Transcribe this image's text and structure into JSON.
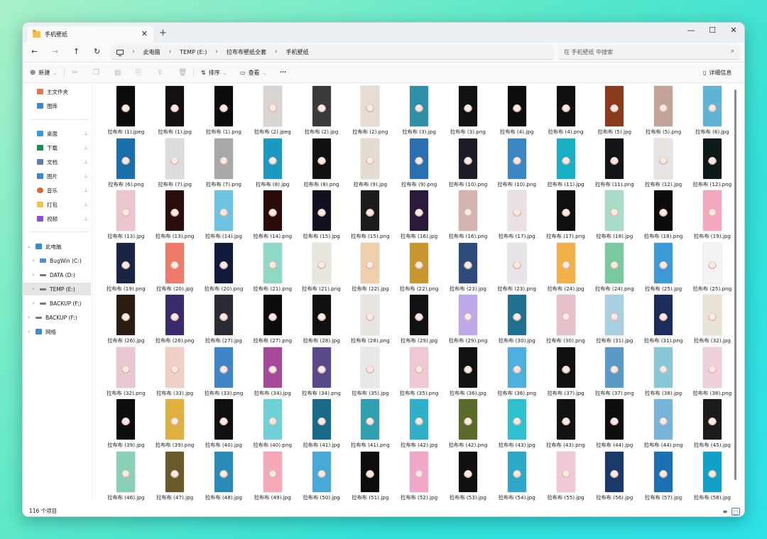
{
  "window": {
    "tab_title": "手机壁纸",
    "new_tab": "+",
    "close_tab": "✕",
    "minimize": "—",
    "maximize": "☐",
    "close": "✕"
  },
  "nav": {
    "back": "←",
    "forward": "→",
    "up": "↑",
    "refresh": "↻",
    "breadcrumbs": [
      "此电脑",
      "TEMP (E:)",
      "拉布布壁纸全套",
      "手机壁纸"
    ],
    "separator": "›",
    "search_placeholder": "在 手机壁纸 中搜索"
  },
  "toolbar": {
    "new_label": "新建",
    "sort_label": "排序",
    "view_label": "查看",
    "more_label": "···",
    "details_label": "详细信息"
  },
  "sidebar": {
    "quick": [
      {
        "label": "主文件夹",
        "icon": "home-icon",
        "color": "#e07a4a"
      },
      {
        "label": "图库",
        "icon": "gallery-icon",
        "color": "#3d86d8"
      }
    ],
    "pinned": [
      {
        "label": "桌面",
        "icon": "desktop-icon",
        "color": "#3a9ad9"
      },
      {
        "label": "下载",
        "icon": "download-icon",
        "color": "#1f8b4c"
      },
      {
        "label": "文档",
        "icon": "documents-icon",
        "color": "#5a7fa8"
      },
      {
        "label": "图片",
        "icon": "pictures-icon",
        "color": "#3f86c8"
      },
      {
        "label": "音乐",
        "icon": "music-icon",
        "color": "#e0663a"
      },
      {
        "label": "打包",
        "icon": "folder-icon",
        "color": "#f2c34c"
      },
      {
        "label": "视频",
        "icon": "videos-icon",
        "color": "#8c4fd0"
      }
    ],
    "pin_glyph": "📌",
    "this_pc": "此电脑",
    "drives": [
      {
        "label": "BugWin (C:)",
        "selected": false
      },
      {
        "label": "DATA (D:)",
        "selected": false
      },
      {
        "label": "TEMP (E:)",
        "selected": true
      },
      {
        "label": "BACKUP (F:)",
        "selected": false
      }
    ],
    "external": "BACKUP (F:)",
    "network": "网络"
  },
  "files": [
    "拉布布 (1).jpeg",
    "拉布布 (1).jpg",
    "拉布布 (1).png",
    "拉布布 (2).jpeg",
    "拉布布 (2).jpg",
    "拉布布 (2).png",
    "拉布布 (3).jpg",
    "拉布布 (3).png",
    "拉布布 (4).jpg",
    "拉布布 (4).png",
    "拉布布 (5).jpg",
    "拉布布 (5).png",
    "拉布布 (6).jpg",
    "拉布布 (6).png",
    "拉布布 (7).jpg",
    "拉布布 (7).png",
    "拉布布 (8).jpg",
    "拉布布 (8).png",
    "拉布布 (9).jpg",
    "拉布布 (9).png",
    "拉布布 (10).png",
    "拉布布 (10).png",
    "拉布布 (11).jpg",
    "拉布布 (11).png",
    "拉布布 (12).jpg",
    "拉布布 (12).png",
    "拉布布 (13).jpg",
    "拉布布 (13).png",
    "拉布布 (14).jpg",
    "拉布布 (14).png",
    "拉布布 (15).jpg",
    "拉布布 (15).png",
    "拉布布 (16).jpg",
    "拉布布 (16).png",
    "拉布布 (17).jpg",
    "拉布布 (17).png",
    "拉布布 (18).jpg",
    "拉布布 (18).png",
    "拉布布 (19).jpg",
    "拉布布 (19).png",
    "拉布布 (20).jpg",
    "拉布布 (20).png",
    "拉布布 (21).png",
    "拉布布 (21).png",
    "拉布布 (22).jpg",
    "拉布布 (22).png",
    "拉布布 (23).jpg",
    "拉布布 (23).png",
    "拉布布 (24).jpg",
    "拉布布 (24).png",
    "拉布布 (25).jpg",
    "拉布布 (25).png",
    "拉布布 (26).jpg",
    "拉布布 (26).png",
    "拉布布 (27).jpg",
    "拉布布 (27).png",
    "拉布布 (28).jpg",
    "拉布布 (28).png",
    "拉布布 (29).jpg",
    "拉布布 (29).png",
    "拉布布 (30).jpg",
    "拉布布 (30).png",
    "拉布布 (31).jpg",
    "拉布布 (31).png",
    "拉布布 (32).jpg",
    "拉布布 (32).png",
    "拉布布 (33).jpg",
    "拉布布 (33).png",
    "拉布布 (34).jpg",
    "拉布布 (34).png",
    "拉布布 (35).jpg",
    "拉布布 (35).png",
    "拉布布 (36).jpg",
    "拉布布 (36).png",
    "拉布布 (37).jpg",
    "拉布布 (37).png",
    "拉布布 (38).jpg",
    "拉布布 (38).png",
    "拉布布 (39).jpg",
    "拉布布 (39).png",
    "拉布布 (40).jpg",
    "拉布布 (40).png",
    "拉布布 (41).jpg",
    "拉布布 (41).png",
    "拉布布 (42).jpg",
    "拉布布 (42).png",
    "拉布布 (43).jpg",
    "拉布布 (43).png",
    "拉布布 (44).jpg",
    "拉布布 (44).png",
    "拉布布 (45).jpg",
    "拉布布 (46).jpg",
    "拉布布 (47).jpg",
    "拉布布 (48).jpg",
    "拉布布 (49).jpg",
    "拉布布 (50).jpg",
    "拉布布 (51).jpg",
    "拉布布 (52).jpg",
    "拉布布 (53).jpg",
    "拉布布 (54).jpg",
    "拉布布 (55).jpg",
    "拉布布 (56).jpg",
    "拉布布 (57).jpg",
    "拉布布 (58).jpg"
  ],
  "thumb_colors": [
    "#0b0b0b",
    "#141010",
    "#0c0c0c",
    "#d9d4cf",
    "#3a3a3a",
    "#e7dcd4",
    "#2f8fa6",
    "#111111",
    "#0d0d0d",
    "#0f0f0f",
    "#8a3b1e",
    "#c2a39a",
    "#5fb3d4",
    "#1b6fa8",
    "#dcdcdc",
    "#a8a8a8",
    "#1a9ac0",
    "#101010",
    "#e4dcd0",
    "#2a6fb2",
    "#1d1d2a",
    "#3d86c4",
    "#1ab0c4",
    "#121418",
    "#e7e3e1",
    "#0e1a1a",
    "#ecc6ce",
    "#2a0e0e",
    "#6fc2e0",
    "#2b0b0b",
    "#111122",
    "#1b1b1b",
    "#2a1b3a",
    "#d4b4b0",
    "#e8e0e4",
    "#0f0f0f",
    "#a9dcc8",
    "#0c0c0c",
    "#f4a8be",
    "#1a2544",
    "#f07a6a",
    "#111a3a",
    "#8fd8c8",
    "#e9e6de",
    "#f0cfae",
    "#c7962c",
    "#2d4b7a",
    "#e8e4ea",
    "#f2b048",
    "#78c8a0",
    "#3b9ad6",
    "#f3f3f3",
    "#2b1d12",
    "#3a2a6a",
    "#2a2a34",
    "#0b0b0b",
    "#101010",
    "#e8e4e0",
    "#121212",
    "#bfa9e8",
    "#1f6f8f",
    "#e6c0c8",
    "#a8d0e0",
    "#1b2b5a",
    "#e9e2d6",
    "#e8c8d0",
    "#f0cfc8",
    "#3f86c8",
    "#a54a9a",
    "#5a4a8a",
    "#e8e8e8",
    "#f0c8d4",
    "#111111",
    "#4fb0e0",
    "#0f0f0f",
    "#5a9ac4",
    "#88c8d8",
    "#f0d0d8",
    "#0d0d0d",
    "#e0b040",
    "#0f0f0f",
    "#6fd0d8",
    "#1a6a8a",
    "#30a0b0",
    "#2fb0c8",
    "#5a6a2a",
    "#2fc0d0",
    "#121212",
    "#0e0e0e",
    "#78b4d8",
    "#1a1a1a",
    "#8ad0b8",
    "#6a5a2a",
    "#2a8ab8",
    "#f4a8b8",
    "#48a8d8",
    "#0d0d0d",
    "#f0a8c8",
    "#101010",
    "#2fa8c8",
    "#f0c8d8",
    "#1a3a6a",
    "#1a70b0",
    "#10a0c8",
    "#1a8ad0"
  ],
  "status": {
    "count": "116 个项目",
    "view_list": "≡",
    "view_grid": "▢"
  }
}
